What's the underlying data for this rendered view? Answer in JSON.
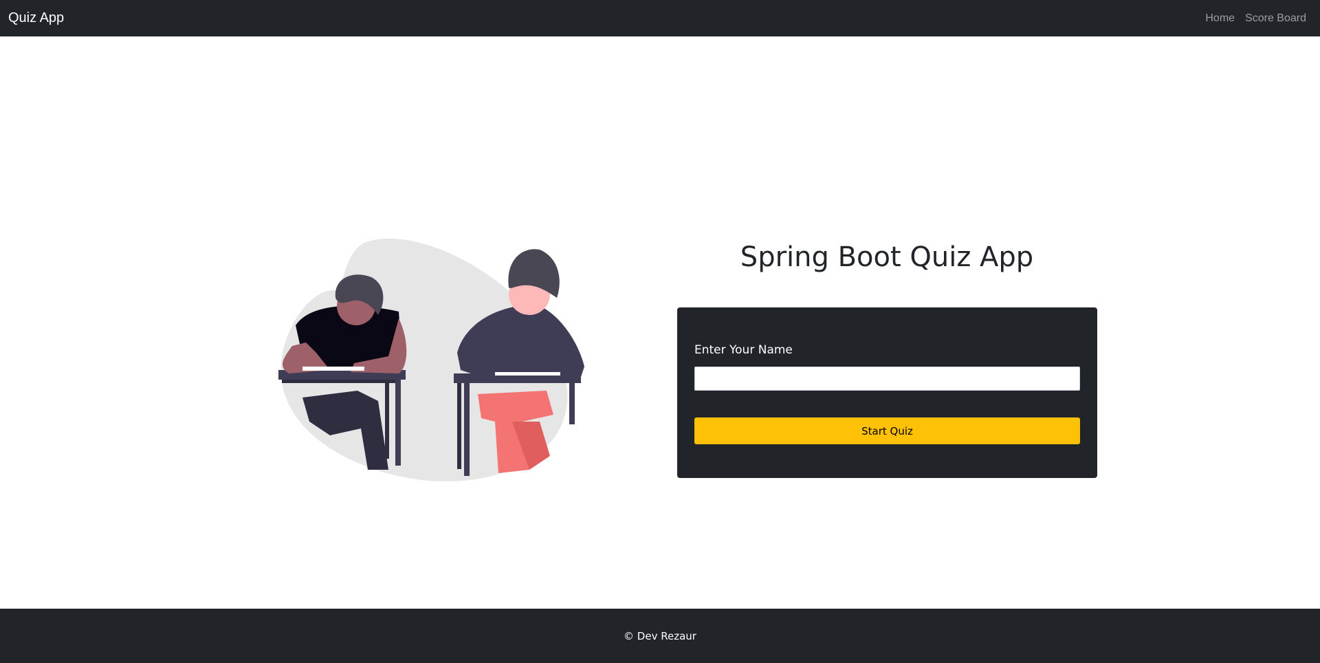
{
  "navbar": {
    "brand": "Quiz App",
    "links": [
      "Home",
      "Score Board"
    ]
  },
  "main": {
    "title": "Spring Boot Quiz App",
    "form": {
      "label": "Enter Your Name",
      "name_value": "",
      "button_label": "Start Quiz"
    },
    "illustration_icon": "students-taking-exam-illustration"
  },
  "footer": {
    "text": "© Dev Rezaur"
  },
  "colors": {
    "dark": "#212529",
    "accent": "#ffc107",
    "nav_link": "rgba(255,255,255,0.55)"
  }
}
